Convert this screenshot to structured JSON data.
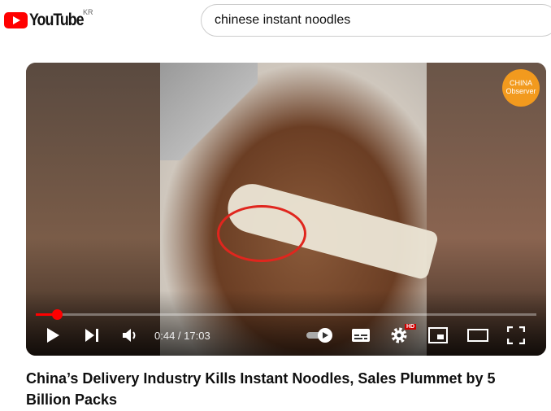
{
  "header": {
    "logo_text": "YouTube",
    "region": "KR",
    "search_value": "chinese instant noodles"
  },
  "player": {
    "watermark": "CHINA Observer",
    "current_time": "0:44",
    "duration": "17:03",
    "time_display": "0:44 / 17:03",
    "progress_percent": 4.3,
    "quality_badge": "HD",
    "accent": "#ff0000"
  },
  "video": {
    "title": "China’s Delivery Industry Kills Instant Noodles, Sales Plummet by 5 Billion Packs"
  }
}
